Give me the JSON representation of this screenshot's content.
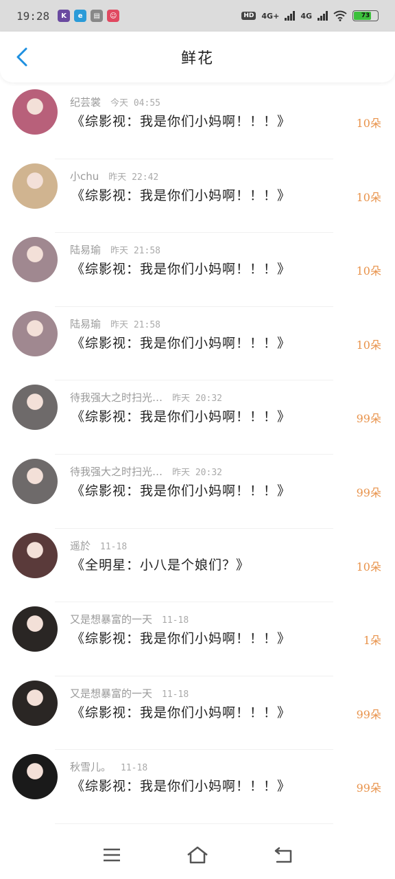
{
  "status_bar": {
    "time": "19:28",
    "network_1": "4G+",
    "network_2": "4G",
    "hd_label": "HD",
    "battery_level": "73",
    "battery_fraction": 0.73,
    "app_icons": [
      {
        "icon": "k-app-icon",
        "glyph": "K",
        "color": "#6a4aa0"
      },
      {
        "icon": "browser-app-icon",
        "glyph": "e",
        "color": "#2a9bd8"
      },
      {
        "icon": "document-app-icon",
        "glyph": "▤",
        "color": "#888888"
      },
      {
        "icon": "smile-app-icon",
        "glyph": "☺",
        "color": "#e04860"
      }
    ]
  },
  "header": {
    "title": "鲜花",
    "back_icon": "chevron-left-icon",
    "accent_color": "#1e90e0"
  },
  "items": [
    {
      "name": "纪芸裳",
      "time": "今天 04:55",
      "book": "《综影视：我是你们小妈啊！！！》",
      "count": "10朵",
      "avatar_color": "#b8607a"
    },
    {
      "name": "小chu",
      "time": "昨天 22:42",
      "book": "《综影视：我是你们小妈啊！！！》",
      "count": "10朵",
      "avatar_color": "#d0b490"
    },
    {
      "name": "陆易瑜",
      "time": "昨天 21:58",
      "book": "《综影视：我是你们小妈啊！！！》",
      "count": "10朵",
      "avatar_color": "#a08890"
    },
    {
      "name": "陆易瑜",
      "time": "昨天 21:58",
      "book": "《综影视：我是你们小妈啊！！！》",
      "count": "10朵",
      "avatar_color": "#a08890"
    },
    {
      "name": "待我强大之时扫光…",
      "time": "昨天 20:32",
      "book": "《综影视：我是你们小妈啊！！！》",
      "count": "99朵",
      "avatar_color": "#6e6a6a"
    },
    {
      "name": "待我强大之时扫光…",
      "time": "昨天 20:32",
      "book": "《综影视：我是你们小妈啊！！！》",
      "count": "99朵",
      "avatar_color": "#6e6a6a"
    },
    {
      "name": "遥於",
      "time": "11-18",
      "book": "《全明星：小八是个娘们？》",
      "count": "10朵",
      "avatar_color": "#5a3a3a"
    },
    {
      "name": "又是想暴富的一天",
      "time": "11-18",
      "book": "《综影视：我是你们小妈啊！！！》",
      "count": "1朵",
      "avatar_color": "#2a2624"
    },
    {
      "name": "又是想暴富的一天",
      "time": "11-18",
      "book": "《综影视：我是你们小妈啊！！！》",
      "count": "99朵",
      "avatar_color": "#2a2624"
    },
    {
      "name": "秋雪儿。",
      "time": "11-18",
      "book": "《综影视：我是你们小妈啊！！！》",
      "count": "99朵",
      "avatar_color": "#1a1a1a"
    }
  ],
  "count_color": "#e8924a",
  "navbar": {
    "menu_icon": "menu-icon",
    "home_icon": "home-icon",
    "back_icon": "return-icon"
  }
}
